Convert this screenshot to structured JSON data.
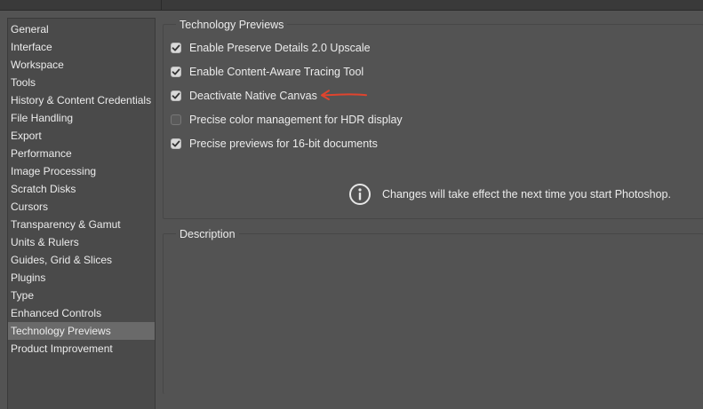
{
  "sidebar": {
    "items": [
      {
        "label": "General",
        "selected": false
      },
      {
        "label": "Interface",
        "selected": false
      },
      {
        "label": "Workspace",
        "selected": false
      },
      {
        "label": "Tools",
        "selected": false
      },
      {
        "label": "History & Content Credentials",
        "selected": false
      },
      {
        "label": "File Handling",
        "selected": false
      },
      {
        "label": "Export",
        "selected": false
      },
      {
        "label": "Performance",
        "selected": false
      },
      {
        "label": "Image Processing",
        "selected": false
      },
      {
        "label": "Scratch Disks",
        "selected": false
      },
      {
        "label": "Cursors",
        "selected": false
      },
      {
        "label": "Transparency & Gamut",
        "selected": false
      },
      {
        "label": "Units & Rulers",
        "selected": false
      },
      {
        "label": "Guides, Grid & Slices",
        "selected": false
      },
      {
        "label": "Plugins",
        "selected": false
      },
      {
        "label": "Type",
        "selected": false
      },
      {
        "label": "Enhanced Controls",
        "selected": false
      },
      {
        "label": "Technology Previews",
        "selected": true
      },
      {
        "label": "Product Improvement",
        "selected": false
      }
    ]
  },
  "tech_previews": {
    "title": "Technology Previews",
    "options": [
      {
        "label": "Enable Preserve Details 2.0 Upscale",
        "checked": true
      },
      {
        "label": "Enable Content-Aware Tracing Tool",
        "checked": true
      },
      {
        "label": "Deactivate Native Canvas",
        "checked": true
      },
      {
        "label": "Precise color management for HDR display",
        "checked": false
      },
      {
        "label": "Precise previews for 16-bit documents",
        "checked": true
      }
    ],
    "notice": "Changes will take effect the next time you start Photoshop.",
    "notice_icon": "info-icon"
  },
  "description": {
    "title": "Description"
  },
  "annotation": {
    "icon": "red-arrow-icon",
    "color": "#e0442e"
  }
}
